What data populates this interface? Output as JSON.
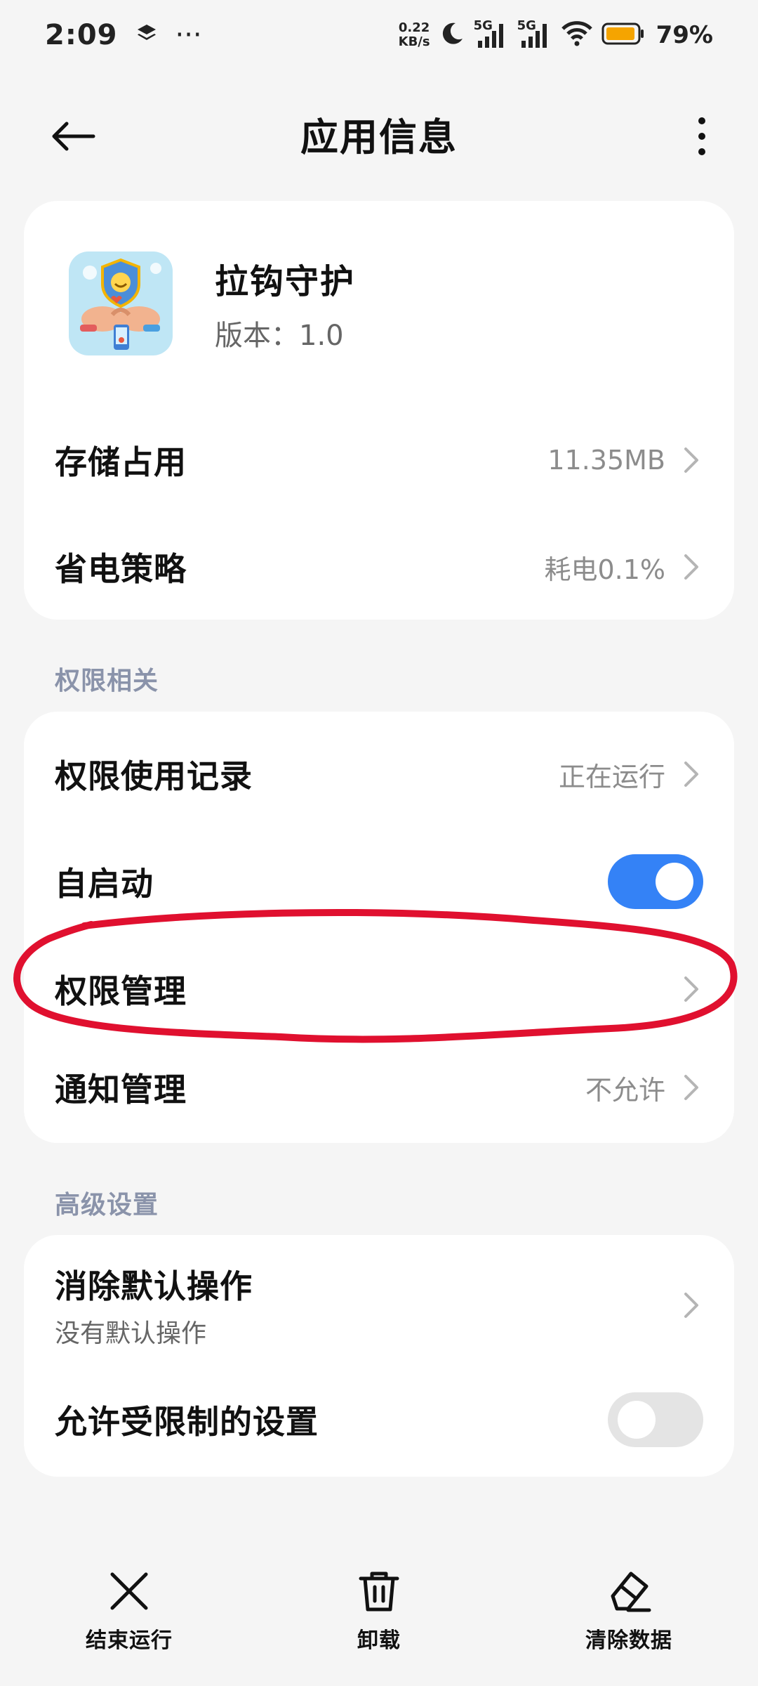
{
  "status_bar": {
    "time": "2:09",
    "overflow": "···",
    "net_speed_value": "0.22",
    "net_speed_unit": "KB/s",
    "signal_1_label": "5G",
    "signal_2_label": "5G",
    "battery_percent": "79%",
    "icons": [
      "layers-icon",
      "moon-icon",
      "signal-icon",
      "wifi-icon",
      "battery-icon"
    ],
    "battery_color": "#f5a400"
  },
  "app_bar": {
    "title": "应用信息"
  },
  "app_info": {
    "name": "拉钩守护",
    "version": "版本：1.0"
  },
  "rows_main": [
    {
      "label": "存储占用",
      "value": "11.35MB"
    },
    {
      "label": "省电策略",
      "value": "耗电0.1%"
    }
  ],
  "section_permissions": {
    "header": "权限相关",
    "usage_label": "权限使用记录",
    "usage_value": "正在运行",
    "autostart_label": "自启动",
    "autostart_on": true,
    "manage_label": "权限管理",
    "notify_label": "通知管理",
    "notify_value": "不允许"
  },
  "section_advanced": {
    "header": "高级设置",
    "clear_default_label": "消除默认操作",
    "clear_default_sub": "没有默认操作",
    "restricted_label": "允许受限制的设置",
    "restricted_on": false
  },
  "bottom_bar": {
    "stop_label": "结束运行",
    "uninstall_label": "卸载",
    "clear_data_label": "清除数据"
  },
  "colors": {
    "accent": "#3482f6",
    "annotation": "#e0102f",
    "section_header": "#8a93aa"
  }
}
